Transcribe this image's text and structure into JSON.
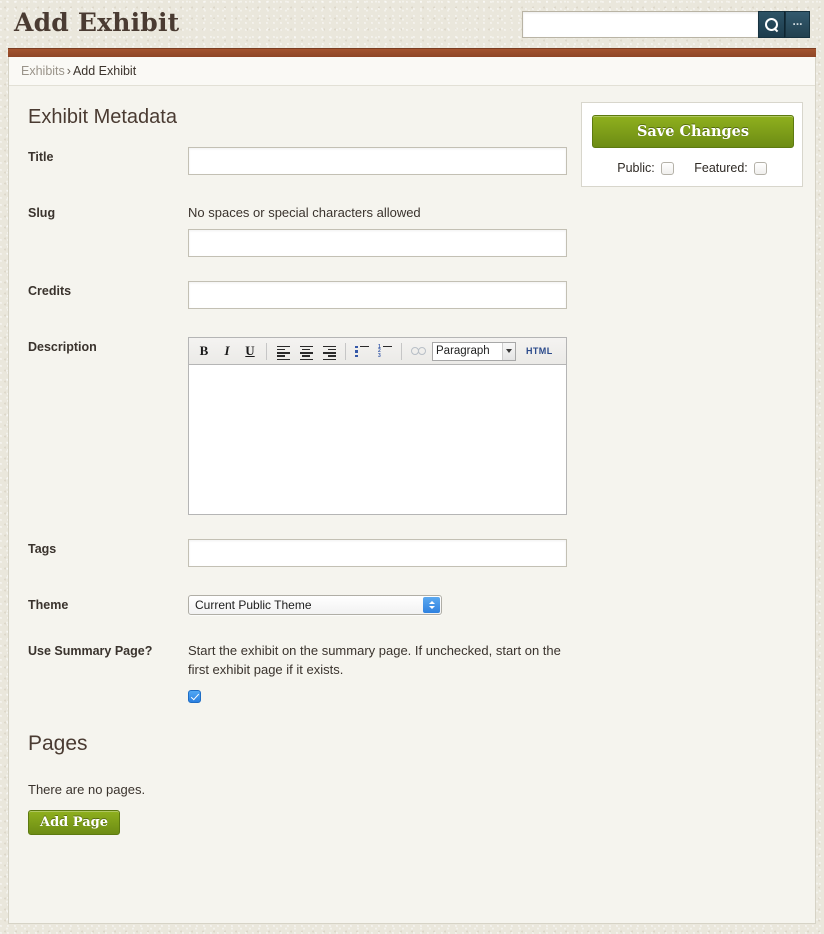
{
  "header": {
    "title": "Add Exhibit",
    "search_placeholder": "",
    "search_value": "",
    "search_icon": "search-icon",
    "advanced_label": "..."
  },
  "breadcrumb": {
    "parent": "Exhibits",
    "separator": "›",
    "current": "Add Exhibit"
  },
  "main": {
    "section_title": "Exhibit Metadata",
    "fields": {
      "title": {
        "label": "Title",
        "value": ""
      },
      "slug": {
        "label": "Slug",
        "helper": "No spaces or special characters allowed",
        "value": ""
      },
      "credits": {
        "label": "Credits",
        "value": ""
      },
      "description": {
        "label": "Description",
        "value": ""
      },
      "tags": {
        "label": "Tags",
        "value": ""
      },
      "theme": {
        "label": "Theme",
        "selected": "Current Public Theme"
      },
      "summary": {
        "label": "Use Summary Page?",
        "helper": "Start the exhibit on the summary page. If unchecked, start on the first exhibit page if it exists.",
        "checked": true
      }
    },
    "editor": {
      "bold": "B",
      "italic": "I",
      "underline": "U",
      "align_left": "align-left-icon",
      "align_center": "align-center-icon",
      "align_right": "align-right-icon",
      "bullet_list": "bullet-list-icon",
      "numbered_list": "numbered-list-icon",
      "link": "link-icon",
      "format_selected": "Paragraph",
      "html_label": "HTML"
    }
  },
  "pages": {
    "title": "Pages",
    "empty_message": "There are no pages.",
    "add_button": "Add Page"
  },
  "save_panel": {
    "save_label": "Save Changes",
    "public_label": "Public:",
    "public_checked": false,
    "featured_label": "Featured:",
    "featured_checked": false
  },
  "colors": {
    "accent_green": "#7d9e18",
    "rust_bar": "#9b4c29",
    "header_bg": "#eae7dc",
    "panel_bg": "#f5f4ee",
    "search_button": "#23424f",
    "checkbox_blue": "#2a7fe0"
  }
}
